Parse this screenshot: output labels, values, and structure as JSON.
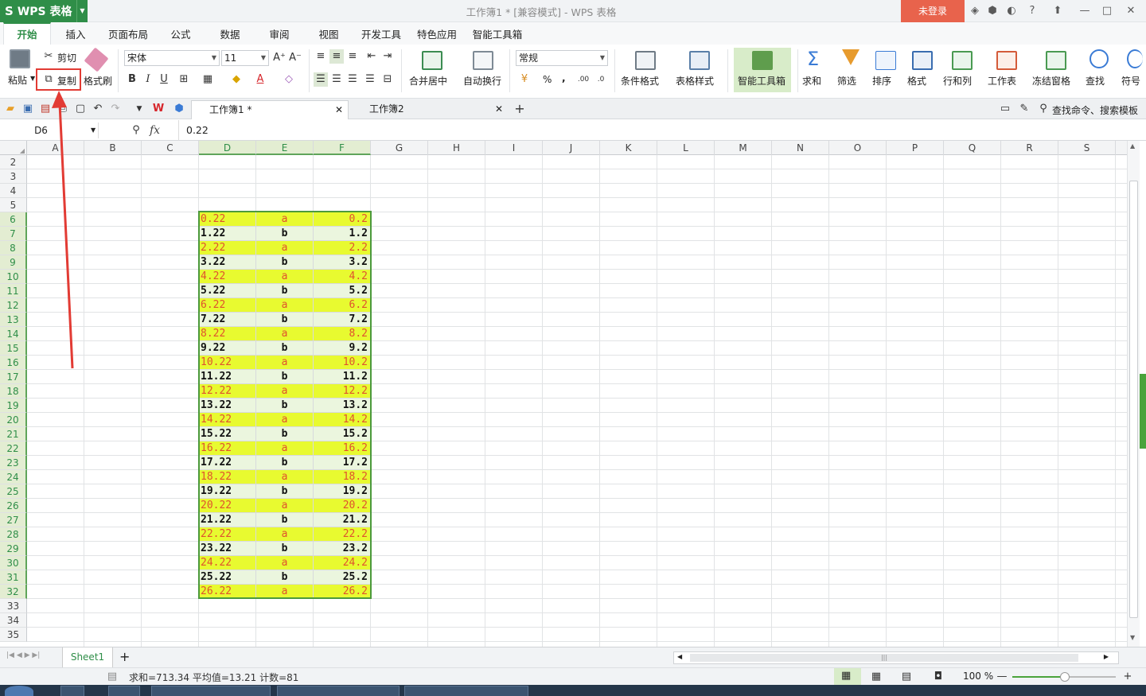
{
  "app": {
    "logo": "WPS 表格",
    "title": "工作簿1 * [兼容模式] - WPS 表格",
    "login": "未登录"
  },
  "ribbon_tabs": [
    "开始",
    "插入",
    "页面布局",
    "公式",
    "数据",
    "审阅",
    "视图",
    "开发工具",
    "特色应用",
    "智能工具箱"
  ],
  "ribbon": {
    "paste": "粘贴",
    "cut": "剪切",
    "copy": "复制",
    "format_painter": "格式刷",
    "font_name": "宋体",
    "font_size": "11",
    "merge_center": "合并居中",
    "wrap_text": "自动换行",
    "number_format": "常规",
    "percent": "%",
    "comma": ",",
    "cond_format": "条件格式",
    "table_style": "表格样式",
    "smart_toolbox": "智能工具箱",
    "sum": "求和",
    "filter": "筛选",
    "sort": "排序",
    "format": "格式",
    "row_col": "行和列",
    "worksheet": "工作表",
    "freeze": "冻结窗格",
    "find": "查找",
    "symbol": "符号"
  },
  "doc_tabs": [
    "工作簿1 *",
    "工作簿2"
  ],
  "search_hint": "查找命令、搜索模板",
  "formula_bar": {
    "cell_ref": "D6",
    "fx": "fx",
    "value": "0.22"
  },
  "columns": [
    "A",
    "B",
    "C",
    "D",
    "E",
    "F",
    "G",
    "H",
    "I",
    "J",
    "K",
    "L",
    "M",
    "N",
    "O",
    "P",
    "Q",
    "R",
    "S"
  ],
  "rows": [
    "2",
    "3",
    "4",
    "5",
    "6",
    "7",
    "8",
    "9",
    "10",
    "11",
    "12",
    "13",
    "14",
    "15",
    "16",
    "17",
    "18",
    "19",
    "20",
    "21",
    "22",
    "23",
    "24",
    "25",
    "26",
    "27",
    "28",
    "29",
    "30",
    "31",
    "32",
    "33",
    "34",
    "35"
  ],
  "cells": [
    [
      "0.22",
      "a",
      "0.2"
    ],
    [
      "1.22",
      "b",
      "1.2"
    ],
    [
      "2.22",
      "a",
      "2.2"
    ],
    [
      "3.22",
      "b",
      "3.2"
    ],
    [
      "4.22",
      "a",
      "4.2"
    ],
    [
      "5.22",
      "b",
      "5.2"
    ],
    [
      "6.22",
      "a",
      "6.2"
    ],
    [
      "7.22",
      "b",
      "7.2"
    ],
    [
      "8.22",
      "a",
      "8.2"
    ],
    [
      "9.22",
      "b",
      "9.2"
    ],
    [
      "10.22",
      "a",
      "10.2"
    ],
    [
      "11.22",
      "b",
      "11.2"
    ],
    [
      "12.22",
      "a",
      "12.2"
    ],
    [
      "13.22",
      "b",
      "13.2"
    ],
    [
      "14.22",
      "a",
      "14.2"
    ],
    [
      "15.22",
      "b",
      "15.2"
    ],
    [
      "16.22",
      "a",
      "16.2"
    ],
    [
      "17.22",
      "b",
      "17.2"
    ],
    [
      "18.22",
      "a",
      "18.2"
    ],
    [
      "19.22",
      "b",
      "19.2"
    ],
    [
      "20.22",
      "a",
      "20.2"
    ],
    [
      "21.22",
      "b",
      "21.2"
    ],
    [
      "22.22",
      "a",
      "22.2"
    ],
    [
      "23.22",
      "b",
      "23.2"
    ],
    [
      "24.22",
      "a",
      "24.2"
    ],
    [
      "25.22",
      "b",
      "25.2"
    ],
    [
      "26.22",
      "a",
      "26.2"
    ]
  ],
  "sheet_tab": "Sheet1",
  "status": {
    "text": "求和=713.34  平均值=13.21  计数=81",
    "zoom": "100 %"
  },
  "colors": {
    "brand": "#2f8e48",
    "highlight": "#e8fa30",
    "accent_text": "#e0522d",
    "selection": "#4c9a3c",
    "arrow": "#e23b34"
  }
}
